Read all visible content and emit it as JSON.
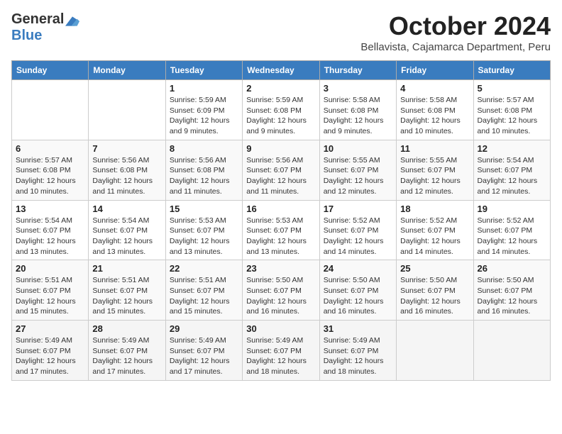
{
  "header": {
    "logo_general": "General",
    "logo_blue": "Blue",
    "month": "October 2024",
    "location": "Bellavista, Cajamarca Department, Peru"
  },
  "days_of_week": [
    "Sunday",
    "Monday",
    "Tuesday",
    "Wednesday",
    "Thursday",
    "Friday",
    "Saturday"
  ],
  "weeks": [
    [
      {
        "day": "",
        "info": ""
      },
      {
        "day": "",
        "info": ""
      },
      {
        "day": "1",
        "info": "Sunrise: 5:59 AM\nSunset: 6:09 PM\nDaylight: 12 hours and 9 minutes."
      },
      {
        "day": "2",
        "info": "Sunrise: 5:59 AM\nSunset: 6:08 PM\nDaylight: 12 hours and 9 minutes."
      },
      {
        "day": "3",
        "info": "Sunrise: 5:58 AM\nSunset: 6:08 PM\nDaylight: 12 hours and 9 minutes."
      },
      {
        "day": "4",
        "info": "Sunrise: 5:58 AM\nSunset: 6:08 PM\nDaylight: 12 hours and 10 minutes."
      },
      {
        "day": "5",
        "info": "Sunrise: 5:57 AM\nSunset: 6:08 PM\nDaylight: 12 hours and 10 minutes."
      }
    ],
    [
      {
        "day": "6",
        "info": "Sunrise: 5:57 AM\nSunset: 6:08 PM\nDaylight: 12 hours and 10 minutes."
      },
      {
        "day": "7",
        "info": "Sunrise: 5:56 AM\nSunset: 6:08 PM\nDaylight: 12 hours and 11 minutes."
      },
      {
        "day": "8",
        "info": "Sunrise: 5:56 AM\nSunset: 6:08 PM\nDaylight: 12 hours and 11 minutes."
      },
      {
        "day": "9",
        "info": "Sunrise: 5:56 AM\nSunset: 6:07 PM\nDaylight: 12 hours and 11 minutes."
      },
      {
        "day": "10",
        "info": "Sunrise: 5:55 AM\nSunset: 6:07 PM\nDaylight: 12 hours and 12 minutes."
      },
      {
        "day": "11",
        "info": "Sunrise: 5:55 AM\nSunset: 6:07 PM\nDaylight: 12 hours and 12 minutes."
      },
      {
        "day": "12",
        "info": "Sunrise: 5:54 AM\nSunset: 6:07 PM\nDaylight: 12 hours and 12 minutes."
      }
    ],
    [
      {
        "day": "13",
        "info": "Sunrise: 5:54 AM\nSunset: 6:07 PM\nDaylight: 12 hours and 13 minutes."
      },
      {
        "day": "14",
        "info": "Sunrise: 5:54 AM\nSunset: 6:07 PM\nDaylight: 12 hours and 13 minutes."
      },
      {
        "day": "15",
        "info": "Sunrise: 5:53 AM\nSunset: 6:07 PM\nDaylight: 12 hours and 13 minutes."
      },
      {
        "day": "16",
        "info": "Sunrise: 5:53 AM\nSunset: 6:07 PM\nDaylight: 12 hours and 13 minutes."
      },
      {
        "day": "17",
        "info": "Sunrise: 5:52 AM\nSunset: 6:07 PM\nDaylight: 12 hours and 14 minutes."
      },
      {
        "day": "18",
        "info": "Sunrise: 5:52 AM\nSunset: 6:07 PM\nDaylight: 12 hours and 14 minutes."
      },
      {
        "day": "19",
        "info": "Sunrise: 5:52 AM\nSunset: 6:07 PM\nDaylight: 12 hours and 14 minutes."
      }
    ],
    [
      {
        "day": "20",
        "info": "Sunrise: 5:51 AM\nSunset: 6:07 PM\nDaylight: 12 hours and 15 minutes."
      },
      {
        "day": "21",
        "info": "Sunrise: 5:51 AM\nSunset: 6:07 PM\nDaylight: 12 hours and 15 minutes."
      },
      {
        "day": "22",
        "info": "Sunrise: 5:51 AM\nSunset: 6:07 PM\nDaylight: 12 hours and 15 minutes."
      },
      {
        "day": "23",
        "info": "Sunrise: 5:50 AM\nSunset: 6:07 PM\nDaylight: 12 hours and 16 minutes."
      },
      {
        "day": "24",
        "info": "Sunrise: 5:50 AM\nSunset: 6:07 PM\nDaylight: 12 hours and 16 minutes."
      },
      {
        "day": "25",
        "info": "Sunrise: 5:50 AM\nSunset: 6:07 PM\nDaylight: 12 hours and 16 minutes."
      },
      {
        "day": "26",
        "info": "Sunrise: 5:50 AM\nSunset: 6:07 PM\nDaylight: 12 hours and 16 minutes."
      }
    ],
    [
      {
        "day": "27",
        "info": "Sunrise: 5:49 AM\nSunset: 6:07 PM\nDaylight: 12 hours and 17 minutes."
      },
      {
        "day": "28",
        "info": "Sunrise: 5:49 AM\nSunset: 6:07 PM\nDaylight: 12 hours and 17 minutes."
      },
      {
        "day": "29",
        "info": "Sunrise: 5:49 AM\nSunset: 6:07 PM\nDaylight: 12 hours and 17 minutes."
      },
      {
        "day": "30",
        "info": "Sunrise: 5:49 AM\nSunset: 6:07 PM\nDaylight: 12 hours and 18 minutes."
      },
      {
        "day": "31",
        "info": "Sunrise: 5:49 AM\nSunset: 6:07 PM\nDaylight: 12 hours and 18 minutes."
      },
      {
        "day": "",
        "info": ""
      },
      {
        "day": "",
        "info": ""
      }
    ]
  ]
}
